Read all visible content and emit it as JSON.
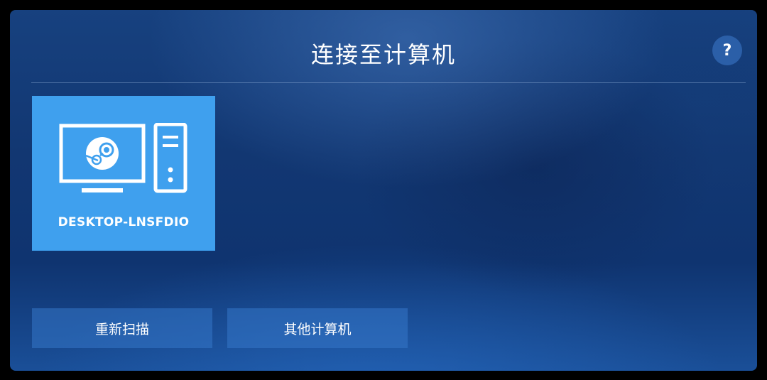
{
  "header": {
    "title": "连接至计算机",
    "help_label": "?",
    "help_icon": "question-mark-icon"
  },
  "computers": [
    {
      "name": "DESKTOP-LNSFDIO",
      "icon": "steam-pc-icon"
    }
  ],
  "actions": {
    "rescan_label": "重新扫描",
    "other_label": "其他计算机"
  },
  "colors": {
    "tile": "#3fa0ee",
    "background": "#123772",
    "button": "#2b5fa8"
  }
}
